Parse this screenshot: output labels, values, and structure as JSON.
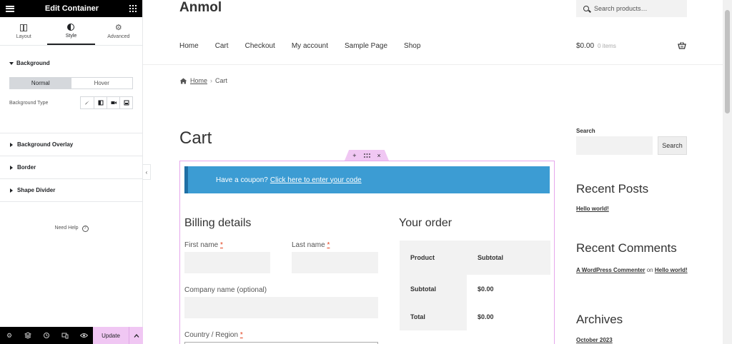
{
  "panel": {
    "title": "Edit Container",
    "tabs": [
      {
        "label": "Layout"
      },
      {
        "label": "Style"
      },
      {
        "label": "Advanced"
      }
    ],
    "background": {
      "title": "Background",
      "state_normal": "Normal",
      "state_hover": "Hover",
      "type_label": "Background Type"
    },
    "sections": [
      "Background Overlay",
      "Border",
      "Shape Divider"
    ],
    "need_help": "Need Help",
    "update_label": "Update"
  },
  "site": {
    "title": "Anmol",
    "search_placeholder": "Search products…",
    "nav": [
      "Home",
      "Cart",
      "Checkout",
      "My account",
      "Sample Page",
      "Shop"
    ],
    "cart_amount": "$0.00",
    "cart_items": "0 items",
    "breadcrumb": {
      "home": "Home",
      "current": "Cart"
    },
    "page_title": "Cart",
    "coupon_text": "Have a coupon?",
    "coupon_link": "Click here to enter your code",
    "billing_heading": "Billing details",
    "fields": {
      "first_name": "First name",
      "last_name": "Last name",
      "company": "Company name (optional)",
      "country": "Country / Region",
      "required_mark": "*"
    },
    "order": {
      "heading": "Your order",
      "col_product": "Product",
      "col_subtotal": "Subtotal",
      "subtotal_label": "Subtotal",
      "subtotal_value": "$0.00",
      "total_label": "Total",
      "total_value": "$0.00"
    },
    "sidebar": {
      "search_label": "Search",
      "search_button": "Search",
      "recent_posts_title": "Recent Posts",
      "recent_post": "Hello world!",
      "recent_comments_title": "Recent Comments",
      "commenter": "A WordPress Commenter",
      "comment_on": "on",
      "comment_post": "Hello world!",
      "archives_title": "Archives",
      "archive_item": "October 2023"
    }
  }
}
